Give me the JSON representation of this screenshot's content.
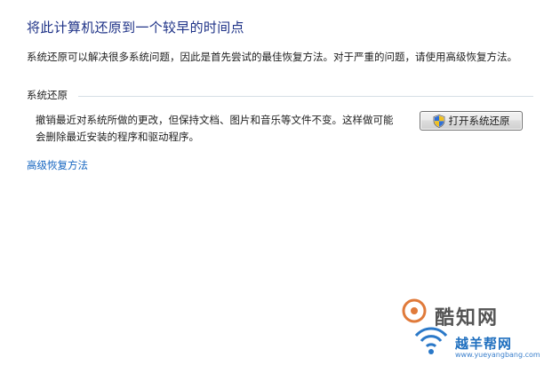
{
  "page": {
    "title": "将此计算机还原到一个较早的时间点",
    "intro": "系统还原可以解决很多系统问题，因此是首先尝试的最佳恢复方法。对于严重的问题，请使用高级恢复方法。"
  },
  "system_restore": {
    "header": "系统还原",
    "desc_line1": "撤销最近对系统所做的更改，但保持文档、图片和音乐等文件不变。这样做可能",
    "desc_line2": "会删除最近安装的程序和驱动程序。",
    "open_button_label": "打开系统还原",
    "button_icon": "uac-shield-icon"
  },
  "links": {
    "advanced_recovery": "高级恢复方法"
  },
  "watermark": {
    "brand_top": "酷知网",
    "brand_bottom": "越羊帮网",
    "url": "www.yueyangbang.com"
  },
  "colors": {
    "title": "#1e3287",
    "link": "#1565c0",
    "divider": "#d5dfe5"
  }
}
